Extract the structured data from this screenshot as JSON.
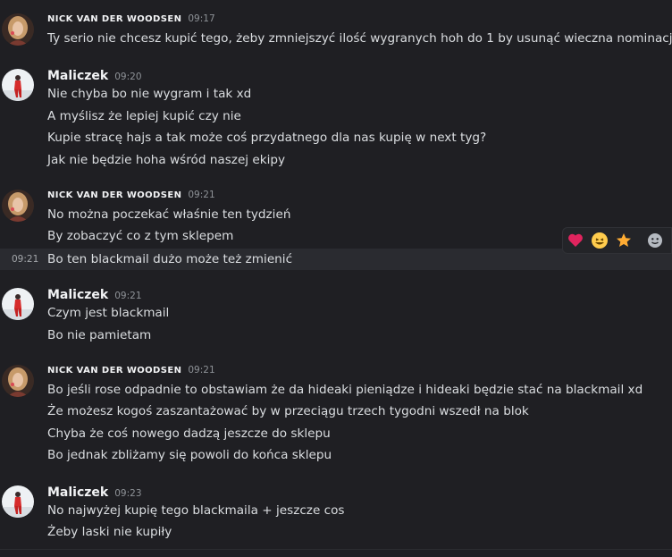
{
  "colors": {
    "background": "#1f1f23",
    "hover_row": "#2a2b30",
    "text": "#dbdee1",
    "username": "#f2f3f5",
    "timestamp": "#8e9297"
  },
  "messages": [
    {
      "author": "NICK VAN DER WOODSEN",
      "time": "09:17",
      "lines": [
        "Ty serio nie chcesz kupić tego, żeby zmniejszyć ilość wygranych hoh do 1 by usunąć wieczna nominacje?"
      ]
    },
    {
      "author": "Maliczek",
      "time": "09:20",
      "lines": [
        "Nie chyba bo nie wygram i tak xd",
        "A myślisz że lepiej kupić czy nie",
        "Kupie stracę hajs a tak może coś przydatnego dla nas kupię w next tyg?",
        "Jak nie będzie hoha wśród naszej ekipy"
      ]
    },
    {
      "author": "NICK VAN DER WOODSEN",
      "time": "09:21",
      "lines": [
        "No można poczekać właśnie ten tydzień",
        "By zobaczyć co z tym sklepem",
        "Bo ten blackmail dużo może też zmienić"
      ],
      "hover_time": "09:21"
    },
    {
      "author": "Maliczek",
      "time": "09:21",
      "lines": [
        "Czym jest blackmail",
        "Bo nie pamietam"
      ]
    },
    {
      "author": "NICK VAN DER WOODSEN",
      "time": "09:21",
      "lines": [
        "Bo jeśli rose odpadnie to obstawiam że da hideaki pieniądze i hideaki będzie stać na blackmail xd",
        "Że możesz kogoś zaszantażować by w przeciągu trzech tygodni wszedł na blok",
        "Chyba że coś nowego dadzą jeszcze do sklepu",
        "Bo jednak zbliżamy się powoli do końca sklepu"
      ]
    },
    {
      "author": "Maliczek",
      "time": "09:23",
      "lines": [
        "No najwyżej kupię tego blackmaila + jeszcze cos",
        "Żeby laski nie kupiły"
      ]
    }
  ],
  "toolbar": {
    "reactions": [
      "heart-icon",
      "grinning-face-icon",
      "star-icon",
      "add-reaction-icon"
    ]
  }
}
